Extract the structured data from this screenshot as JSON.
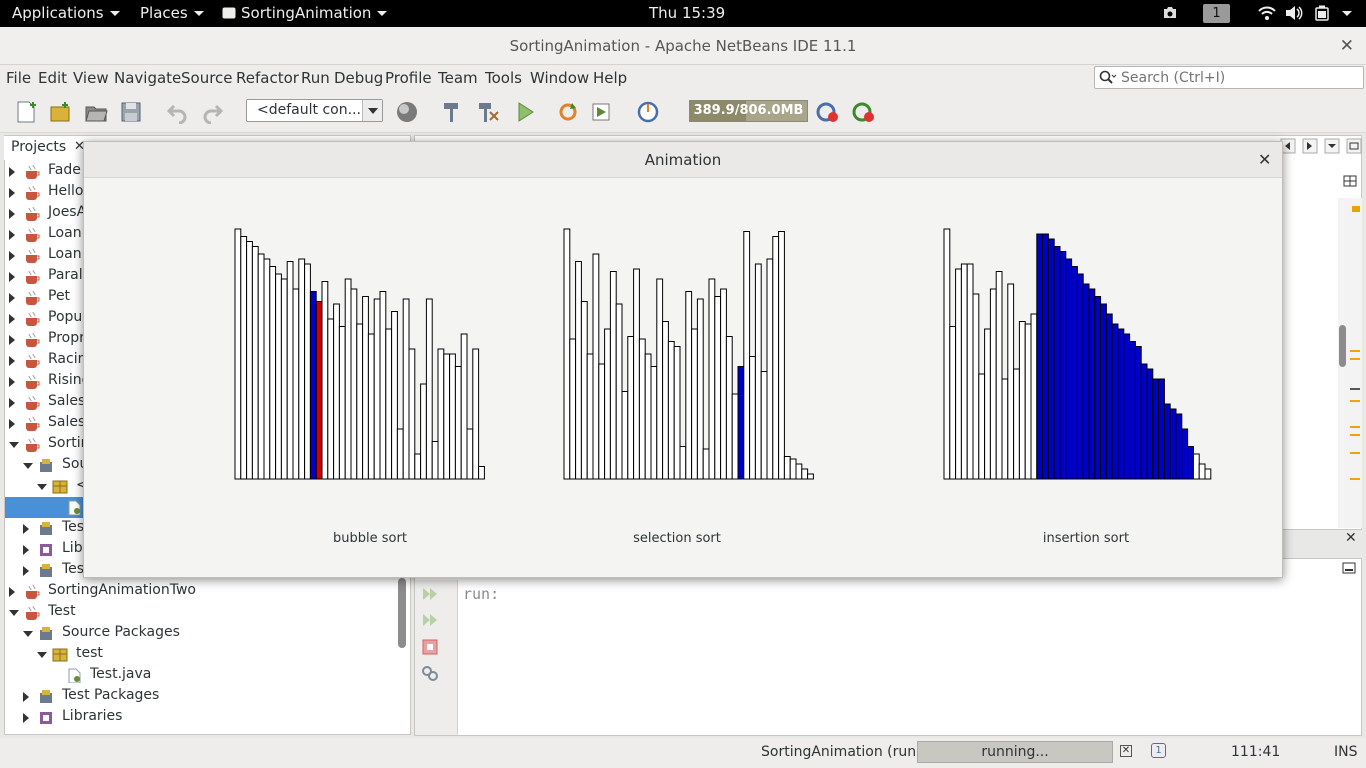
{
  "topbar": {
    "applications": "Applications",
    "places": "Places",
    "app_name": "SortingAnimation",
    "clock": "Thu 15:39",
    "workspace": "1"
  },
  "window": {
    "title": "SortingAnimation - Apache NetBeans IDE 11.1"
  },
  "menu": [
    "File",
    "Edit",
    "View",
    "Navigate",
    "Source",
    "Refactor",
    "Run",
    "Debug",
    "Profile",
    "Team",
    "Tools",
    "Window",
    "Help"
  ],
  "search": {
    "placeholder": "Search (Ctrl+I)"
  },
  "toolbar": {
    "config": "<default con...",
    "memory": "389.9/806.0MB",
    "memory_fraction": 0.48
  },
  "projects": {
    "tab_label": "Projects",
    "items": [
      {
        "label": "Fade",
        "indent": 0,
        "state": "closed",
        "icon": "java-project-icon"
      },
      {
        "label": "Hello",
        "indent": 0,
        "state": "closed",
        "icon": "java-project-icon"
      },
      {
        "label": "JoesA",
        "indent": 0,
        "state": "closed",
        "icon": "java-project-icon"
      },
      {
        "label": "Loan",
        "indent": 0,
        "state": "closed",
        "icon": "java-project-icon"
      },
      {
        "label": "Loan",
        "indent": 0,
        "state": "closed",
        "icon": "java-project-icon"
      },
      {
        "label": "Paral",
        "indent": 0,
        "state": "closed",
        "icon": "java-project-icon"
      },
      {
        "label": "Pet",
        "indent": 0,
        "state": "closed",
        "icon": "java-project-icon"
      },
      {
        "label": "Popul",
        "indent": 0,
        "state": "closed",
        "icon": "java-project-icon"
      },
      {
        "label": "Propr",
        "indent": 0,
        "state": "closed",
        "icon": "java-project-icon"
      },
      {
        "label": "Racin",
        "indent": 0,
        "state": "closed",
        "icon": "java-project-icon"
      },
      {
        "label": "Rising",
        "indent": 0,
        "state": "closed",
        "icon": "java-project-icon"
      },
      {
        "label": "Sales",
        "indent": 0,
        "state": "closed",
        "icon": "java-project-icon"
      },
      {
        "label": "Sales",
        "indent": 0,
        "state": "closed",
        "icon": "java-project-icon"
      },
      {
        "label": "Sortin",
        "indent": 0,
        "state": "open",
        "icon": "java-project-icon"
      },
      {
        "label": "Sou",
        "indent": 1,
        "state": "open",
        "icon": "source-packages-icon"
      },
      {
        "label": "<",
        "indent": 2,
        "state": "open",
        "icon": "package-icon"
      },
      {
        "label": "",
        "indent": 3,
        "state": "none",
        "icon": "java-file-icon",
        "selected": true
      },
      {
        "label": "Tes",
        "indent": 1,
        "state": "closed",
        "icon": "test-packages-icon"
      },
      {
        "label": "Libr",
        "indent": 1,
        "state": "closed",
        "icon": "libraries-icon"
      },
      {
        "label": "Tes",
        "indent": 1,
        "state": "closed",
        "icon": "test-libraries-icon"
      },
      {
        "label": "SortingAnimationTwo",
        "indent": 0,
        "state": "closed",
        "icon": "java-project-icon"
      },
      {
        "label": "Test",
        "indent": 0,
        "state": "open",
        "icon": "java-project-icon"
      },
      {
        "label": "Source Packages",
        "indent": 1,
        "state": "open",
        "icon": "source-packages-icon"
      },
      {
        "label": "test",
        "indent": 2,
        "state": "open",
        "icon": "package-icon"
      },
      {
        "label": "Test.java",
        "indent": 3,
        "state": "none",
        "icon": "java-file-icon"
      },
      {
        "label": "Test Packages",
        "indent": 1,
        "state": "closed",
        "icon": "test-packages-icon"
      },
      {
        "label": "Libraries",
        "indent": 1,
        "state": "closed",
        "icon": "libraries-icon"
      }
    ]
  },
  "output": {
    "text": "run:"
  },
  "status": {
    "task": "SortingAnimation (run)",
    "progress": "running...",
    "position": "111:41",
    "mode": "INS"
  },
  "dialog": {
    "title": "Animation",
    "colors": {
      "bar": "#ffffff",
      "outline": "#000000",
      "highlight_blue": "#0000cc",
      "highlight_red": "#cc0000"
    },
    "panels": [
      {
        "label": "bubble sort",
        "values": [
          100,
          97,
          95,
          93,
          90,
          88,
          85,
          82,
          80,
          87,
          76,
          88,
          86,
          75,
          71,
          79,
          64,
          70,
          61,
          80,
          76,
          62,
          73,
          58,
          72,
          75,
          60,
          67,
          20,
          72,
          52,
          10,
          38,
          72,
          15,
          52,
          50,
          50,
          45,
          58,
          20,
          52,
          5
        ],
        "blue": [
          13
        ],
        "red": [
          14
        ]
      },
      {
        "label": "selection sort",
        "values": [
          100,
          56,
          87,
          71,
          50,
          90,
          46,
          60,
          83,
          70,
          35,
          57,
          84,
          56,
          50,
          45,
          80,
          63,
          55,
          53,
          13,
          75,
          60,
          72,
          12,
          80,
          73,
          76,
          57,
          34,
          45,
          99,
          49,
          86,
          43,
          88,
          97,
          99,
          9,
          8,
          6,
          4,
          2
        ],
        "blue": [
          30
        ]
      },
      {
        "label": "insertion sort",
        "values": [
          100,
          61,
          84,
          86,
          86,
          74,
          42,
          60,
          76,
          83,
          40,
          78,
          44,
          63,
          62,
          66,
          98,
          98,
          96,
          93,
          91,
          88,
          85,
          82,
          78,
          76,
          73,
          70,
          66,
          62,
          60,
          58,
          55,
          53,
          46,
          44,
          40,
          40,
          30,
          28,
          26,
          20,
          13,
          10,
          6,
          4
        ],
        "blue_from": 16,
        "blue_to": 42
      }
    ]
  }
}
